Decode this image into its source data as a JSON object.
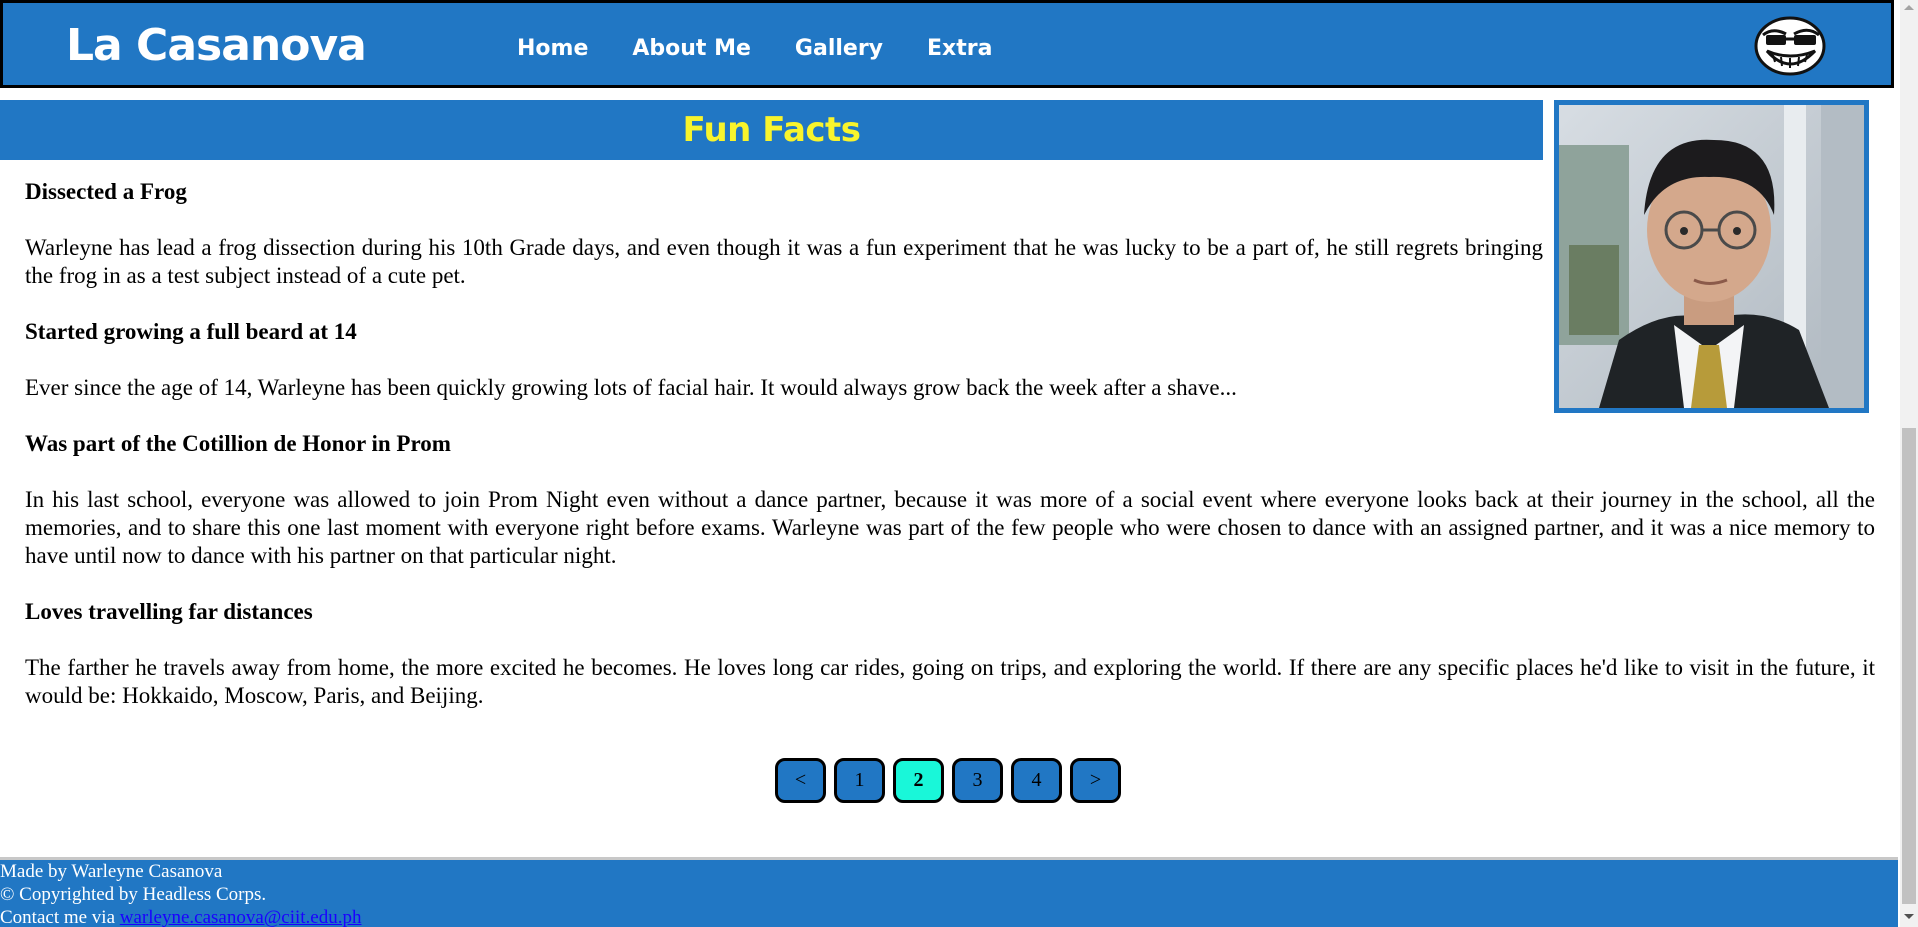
{
  "header": {
    "brand": "La Casanova",
    "nav": [
      "Home",
      "About Me",
      "Gallery",
      "Extra"
    ],
    "logo_icon": "trollface-icon"
  },
  "banner": {
    "title": "Fun Facts"
  },
  "photo": {
    "icon": "profile-photo"
  },
  "facts": [
    {
      "heading": "Dissected a Frog",
      "body": "Warleyne has lead a frog dissection during his 10th Grade days, and even though it was a fun experiment that he was lucky to be a part of, he still regrets bringing the frog in as a test subject instead of a cute pet."
    },
    {
      "heading": "Started growing a full beard at 14",
      "body": "Ever since the age of 14, Warleyne has been quickly growing lots of facial hair. It would always grow back the week after a shave..."
    },
    {
      "heading": "Was part of the Cotillion de Honor in Prom",
      "body": "In his last school, everyone was allowed to join Prom Night even without a dance partner, because it was more of a social event where everyone looks back at their journey in the school, all the memories, and to share this one last moment with everyone right before exams. Warleyne was part of the few people who were chosen to dance with an assigned partner, and it was a nice memory to have until now to dance with his partner on that particular night."
    },
    {
      "heading": "Loves travelling far distances",
      "body": "The farther he travels away from home, the more excited he becomes. He loves long car rides, going on trips, and exploring the world. If there are any specific places he'd like to visit in the future, it would be: Hokkaido, Moscow, Paris, and Beijing."
    }
  ],
  "pagination": {
    "prev": "<",
    "pages": [
      "1",
      "2",
      "3",
      "4"
    ],
    "next": ">",
    "current": "2"
  },
  "footer": {
    "made_by": "Made by Warleyne Casanova",
    "copyright": "© Copyrighted by Headless Corps.",
    "contact_prefix": "Contact me via ",
    "email": "warleyne.casanova@ciit.edu.ph"
  },
  "colors": {
    "primary": "#2177c4",
    "title_yellow": "#f8f42c",
    "active_page": "#19f7d9"
  }
}
